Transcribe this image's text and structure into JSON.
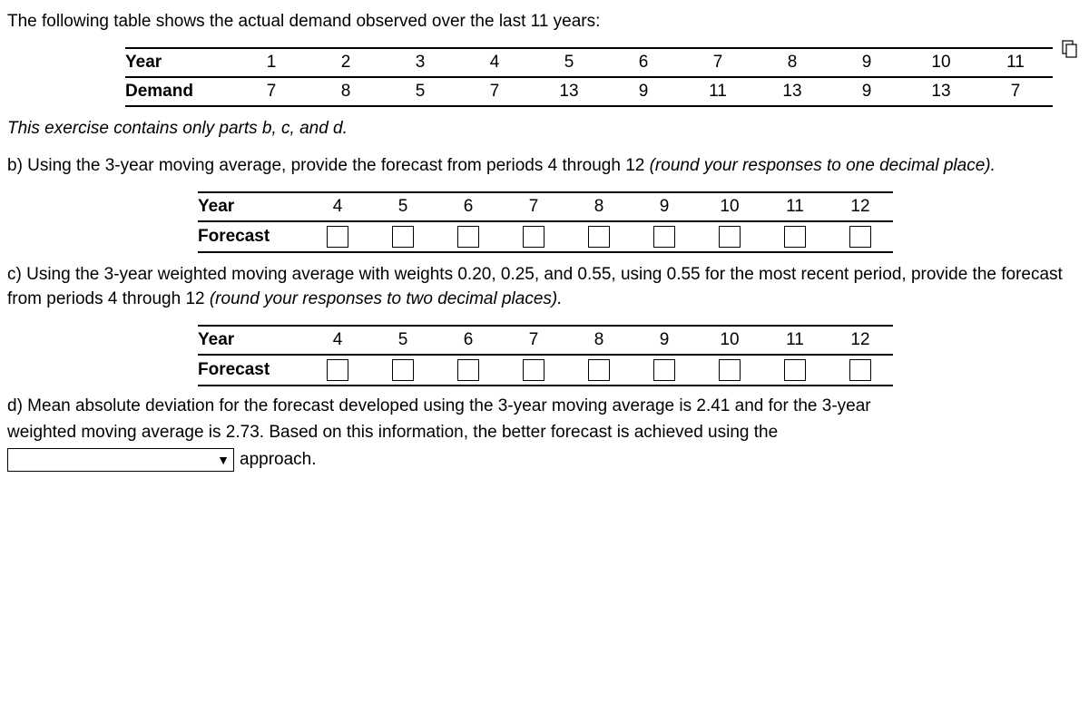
{
  "intro": "The following table shows the actual demand observed over the last 11 years:",
  "demandTable": {
    "yearLabel": "Year",
    "demandLabel": "Demand",
    "years": [
      "1",
      "2",
      "3",
      "4",
      "5",
      "6",
      "7",
      "8",
      "9",
      "10",
      "11"
    ],
    "demand": [
      "7",
      "8",
      "5",
      "7",
      "13",
      "9",
      "11",
      "13",
      "9",
      "13",
      "7"
    ]
  },
  "partsNote": "This exercise contains only parts b, c, and d.",
  "partB": {
    "text": "b) Using the 3-year moving average, provide the forecast from periods 4 through 12 ",
    "italicTail": "(round your responses to one decimal place).",
    "yearLabel": "Year",
    "forecastLabel": "Forecast",
    "years": [
      "4",
      "5",
      "6",
      "7",
      "8",
      "9",
      "10",
      "11",
      "12"
    ]
  },
  "partC": {
    "text": "c) Using the 3-year weighted moving average with weights 0.20, 0.25, and 0.55, using 0.55 for the most recent period, provide the forecast from periods 4 through 12 ",
    "italicTail": "(round your responses to two decimal places).",
    "yearLabel": "Year",
    "forecastLabel": "Forecast",
    "years": [
      "4",
      "5",
      "6",
      "7",
      "8",
      "9",
      "10",
      "11",
      "12"
    ]
  },
  "partD": {
    "line1": "d) Mean absolute deviation for the forecast developed using the 3-year moving average is 2.41 and for the 3-year",
    "line2": "weighted moving average is 2.73.  Based on this information, the better forecast is achieved using the",
    "tail": "approach."
  },
  "chart_data": {
    "type": "table",
    "title": "Actual demand observed over the last 11 years",
    "columns": [
      "Year",
      "Demand"
    ],
    "rows": [
      [
        1,
        7
      ],
      [
        2,
        8
      ],
      [
        3,
        5
      ],
      [
        4,
        7
      ],
      [
        5,
        13
      ],
      [
        6,
        9
      ],
      [
        7,
        11
      ],
      [
        8,
        13
      ],
      [
        9,
        9
      ],
      [
        10,
        13
      ],
      [
        11,
        7
      ]
    ]
  }
}
